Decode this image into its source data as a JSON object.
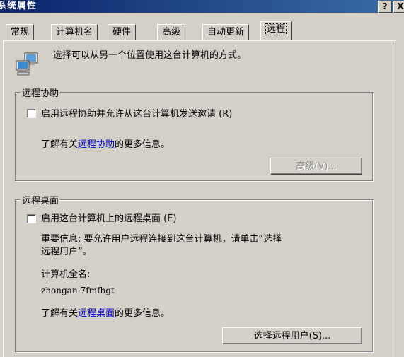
{
  "window": {
    "title": "系统属性",
    "help_btn": "?",
    "close_btn": "X"
  },
  "tabs": [
    {
      "label": "常规"
    },
    {
      "label": "计算机名"
    },
    {
      "label": "硬件"
    },
    {
      "label": "高级"
    },
    {
      "label": "自动更新"
    },
    {
      "label": "远程"
    }
  ],
  "intro": {
    "text": "选择可以从另一个位置使用这台计算机的方式。"
  },
  "remote_assistance": {
    "group_title": "远程协助",
    "checkbox_label": "启用远程协助并允许从这台计算机发送邀请",
    "checkbox_accel": "(R)",
    "checked": false,
    "learn_prefix": "了解有关",
    "learn_link": "远程协助",
    "learn_suffix": "的更多信息。",
    "advanced_button": "高级(V)..."
  },
  "remote_desktop": {
    "group_title": "远程桌面",
    "checkbox_label": "启用这台计算机上的远程桌面",
    "checkbox_accel": "(E)",
    "checked": false,
    "important_line1": "重要信息: 要允许用户远程连接到这台计算机，请单击“选择",
    "important_line2": "远程用户”。",
    "fullname_label": "计算机全名:",
    "fullname_value": "zhongan-7fmfhgt",
    "learn_prefix": "了解有关",
    "learn_link": "远程桌面",
    "learn_suffix": "的更多信息。",
    "select_users_button": "选择远程用户(S)..."
  }
}
